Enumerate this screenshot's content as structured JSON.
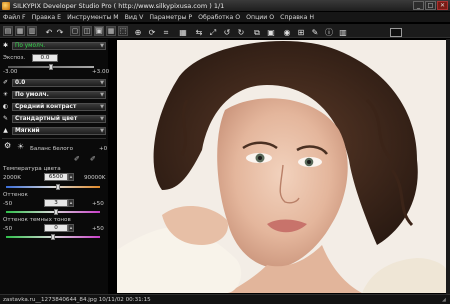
{
  "window": {
    "title": "SILKYPIX Developer Studio Pro ( http://www.silkypixusa.com )   1/1",
    "minimize": "_",
    "maximize": "□",
    "close": "✕"
  },
  "menu": [
    "Файл F",
    "Правка E",
    "Инструменты M",
    "Вид V",
    "Параметры P",
    "Обработка O",
    "Опции O",
    "Справка H"
  ],
  "panel": {
    "preset": "По умолч.",
    "exposure_label": "Экспоз.",
    "exposure_value": "0.0",
    "exposure_min": "-3.00",
    "exposure_max": "+3.00",
    "exposure_level": 0.5,
    "wb_value": "0.0",
    "wb_preset": "По умолч.",
    "contrast_preset": "Средний контраст",
    "color_preset": "Стандартный цвет",
    "sharp_preset": "Мягкий",
    "wb_section_label": "Баланс белого",
    "wb_plus": "+0",
    "temp_label": "Температура цвета",
    "temp_value": "6500",
    "temp_min": "2000K",
    "temp_max": "90000K",
    "temp_level": 0.55,
    "tint_label": "Оттенок",
    "tint_value": "3",
    "tint_min": "-50",
    "tint_max": "+50",
    "tint_level": 0.53,
    "dark_tint_label": "Оттенок темных тонов",
    "dark_tint_value": "0",
    "dark_tint_min": "-50",
    "dark_tint_max": "+50",
    "dark_tint_level": 0.5
  },
  "status": {
    "text": "zastavka.ru__1273840644_84.jpg 10/11/02 00:31:15"
  },
  "icons": {
    "app_logo": "silkypix-logo-icon",
    "monitor": "monitor-icon"
  },
  "colors": {
    "preset_green": "#33d64b"
  }
}
